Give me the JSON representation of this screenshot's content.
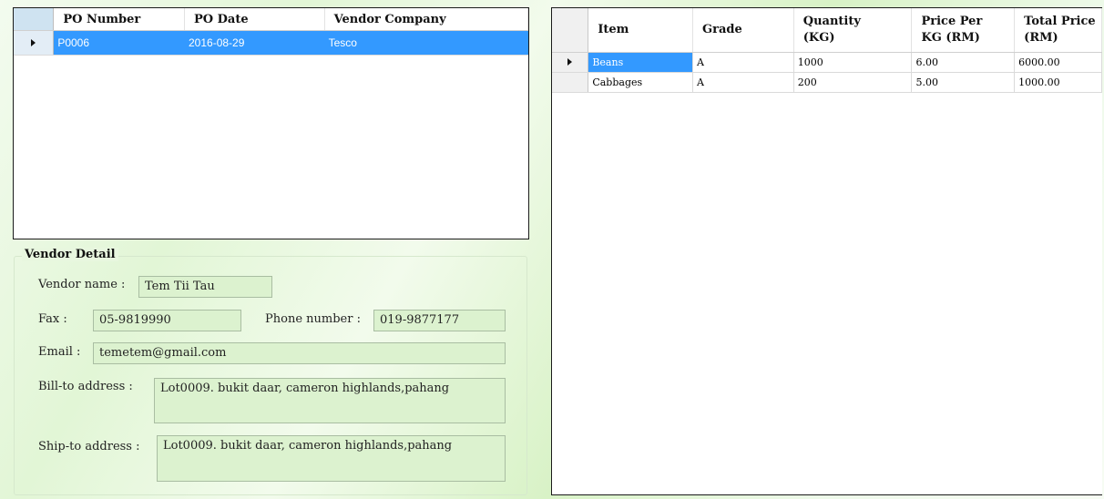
{
  "po_grid": {
    "columns": [
      "PO Number",
      "PO Date",
      "Vendor Company"
    ],
    "rows": [
      {
        "po_number": "P0006",
        "po_date": "2016-08-29",
        "vendor_company": "Tesco"
      }
    ]
  },
  "vendor_detail": {
    "title": "Vendor Detail",
    "vendor_name_label": "Vendor name :",
    "vendor_name": "Tem Tii Tau",
    "fax_label": "Fax :",
    "fax": "05-9819990",
    "phone_label": "Phone number :",
    "phone": "019-9877177",
    "email_label": "Email :",
    "email": "temetem@gmail.com",
    "bill_to_label": "Bill-to address :",
    "bill_to": "Lot0009. bukit daar, cameron highlands,pahang",
    "ship_to_label": "Ship-to address :",
    "ship_to": "Lot0009. bukit daar, cameron highlands,pahang"
  },
  "item_grid": {
    "columns": [
      {
        "line1": "Item",
        "line2": ""
      },
      {
        "line1": "Grade",
        "line2": ""
      },
      {
        "line1": "Quantity",
        "line2": "(KG)"
      },
      {
        "line1": "Price Per",
        "line2": "KG (RM)"
      },
      {
        "line1": "Total Price",
        "line2": "(RM)"
      }
    ],
    "rows": [
      {
        "item": "Beans",
        "grade": "A",
        "quantity": "1000",
        "price_per_kg": "6.00",
        "total_price": "6000.00"
      },
      {
        "item": "Cabbages",
        "grade": "A",
        "quantity": "200",
        "price_per_kg": "5.00",
        "total_price": "1000.00"
      }
    ]
  },
  "icons": {
    "row_selector": "current-row-arrow-icon"
  },
  "colors": {
    "selection": "#3399ff",
    "textbox_bg": "#dcf2cf",
    "header_corner": "#cfe3f1"
  }
}
